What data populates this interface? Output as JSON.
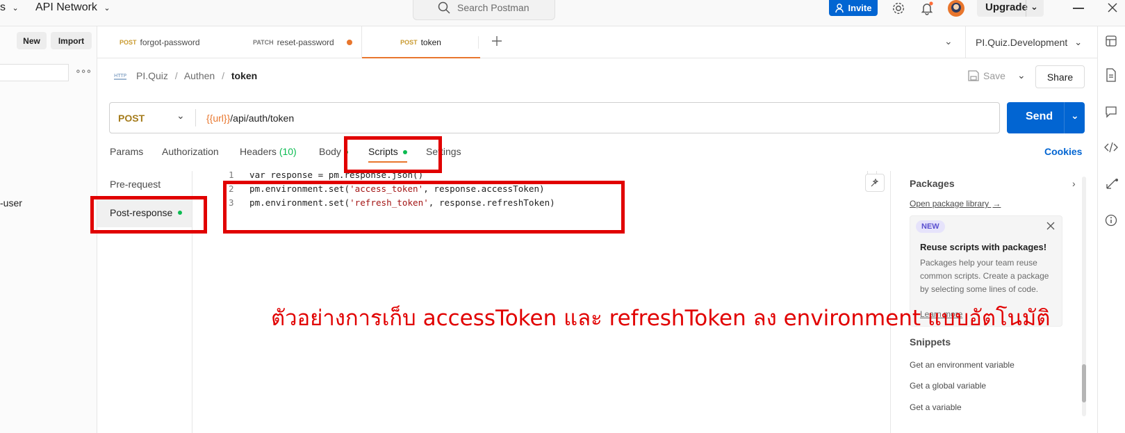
{
  "topbar": {
    "menu_fragment": "s",
    "api_network": "API Network",
    "search_placeholder": "Search Postman",
    "invite": "Invite",
    "upgrade": "Upgrade"
  },
  "sidebar": {
    "new_label": "New",
    "import_label": "Import",
    "item_fragment": "-user"
  },
  "tabs": [
    {
      "method": "POST",
      "name": "forgot-password",
      "method_color": "#c99a2e"
    },
    {
      "method": "PATCH",
      "name": "reset-password",
      "method_color": "#7a7a7a"
    },
    {
      "method": "POST",
      "name": "token",
      "method_color": "#c99a2e"
    }
  ],
  "environment": "PI.Quiz.Development",
  "breadcrumb": {
    "collection": "PI.Quiz",
    "folder": "Authen",
    "request": "token"
  },
  "header_actions": {
    "save": "Save",
    "share": "Share"
  },
  "request": {
    "method": "POST",
    "url_variable": "{{url}}",
    "url_path": "/api/auth/token",
    "send": "Send"
  },
  "subtabs": {
    "params": "Params",
    "authorization": "Authorization",
    "headers": "Headers",
    "headers_count": "(10)",
    "body": "Body",
    "scripts": "Scripts",
    "settings": "Settings",
    "cookies": "Cookies"
  },
  "script_sections": {
    "pre_request": "Pre-request",
    "post_response": "Post-response"
  },
  "code": {
    "line1_num": "1",
    "line1": "var response = pm.response.json()",
    "line2_num": "2",
    "line2_a": "pm.environment.set(",
    "line2_str": "'access_token'",
    "line2_b": ", response.accessToken)",
    "line3_num": "3",
    "line3_a": "pm.environment.set(",
    "line3_str": "'refresh_token'",
    "line3_b": ", response.refreshToken)"
  },
  "packages": {
    "title": "Packages",
    "library_link": "Open package library",
    "badge": "NEW",
    "card_title": "Reuse scripts with packages!",
    "card_text": "Packages help your team reuse common scripts. Create a package by selecting some lines of code.",
    "card_link": "Learn more",
    "snippets_title": "Snippets",
    "snippets": [
      "Get an environment variable",
      "Get a global variable",
      "Get a variable"
    ]
  },
  "annotation": "ตัวอย่างการเก็บ accessToken และ refreshToken ลง environment แบบอัตโนมัติ",
  "colors": {
    "accent_blue": "#0265d2",
    "post_method": "#c99a2e",
    "annotation_red": "#e10000",
    "active_tab_underline": "#e8762d",
    "dot_green": "#0cbb52"
  }
}
